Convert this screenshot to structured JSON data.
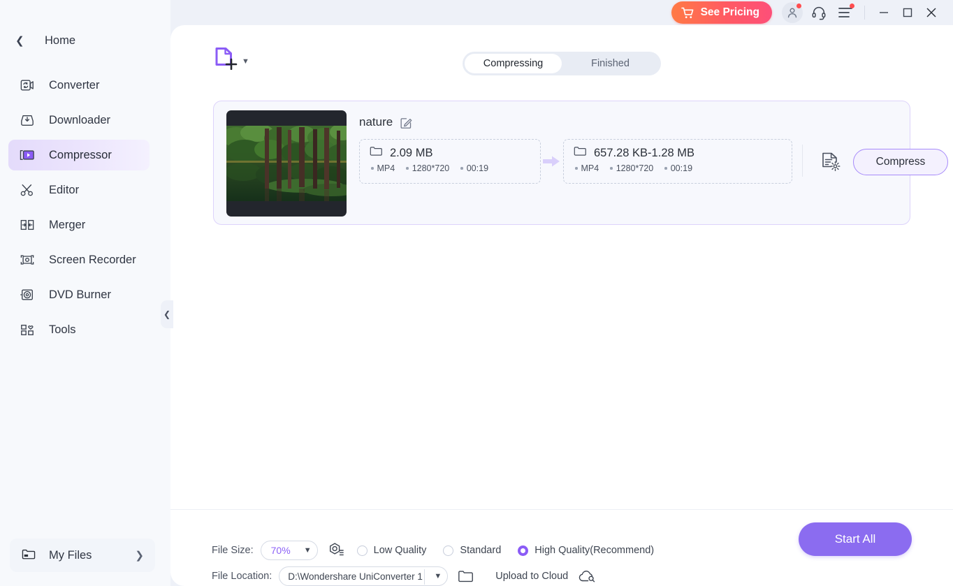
{
  "titlebar": {
    "pricing_label": "See Pricing",
    "cart_icon": "cart-icon",
    "account_icon": "account-icon",
    "support_icon": "headset-icon",
    "menu_icon": "hamburger-menu-icon",
    "minimize_icon": "minimize-icon",
    "maximize_icon": "maximize-icon",
    "close_icon": "close-icon"
  },
  "sidebar": {
    "back_icon": "chevron-left-icon",
    "home_label": "Home",
    "items": [
      {
        "label": "Converter",
        "icon": "converter-icon",
        "active": false
      },
      {
        "label": "Downloader",
        "icon": "downloader-icon",
        "active": false
      },
      {
        "label": "Compressor",
        "icon": "compressor-icon",
        "active": true
      },
      {
        "label": "Editor",
        "icon": "scissors-icon",
        "active": false
      },
      {
        "label": "Merger",
        "icon": "merger-icon",
        "active": false
      },
      {
        "label": "Screen Recorder",
        "icon": "screen-recorder-icon",
        "active": false
      },
      {
        "label": "DVD Burner",
        "icon": "dvd-burner-icon",
        "active": false
      },
      {
        "label": "Tools",
        "icon": "tools-grid-icon",
        "active": false
      }
    ],
    "my_files_label": "My Files",
    "my_files_icon": "folder-icon",
    "my_files_arrow": "chevron-right-icon",
    "collapse_icon": "chevron-left-icon"
  },
  "main": {
    "add_file_icon": "add-file-icon",
    "add_file_caret": "chevron-down-icon",
    "tabs": [
      {
        "label": "Compressing",
        "active": true
      },
      {
        "label": "Finished",
        "active": false
      }
    ]
  },
  "file_card": {
    "name": "nature",
    "edit_icon": "edit-pencil-icon",
    "thumbnail_alt": "forest-lake-thumbnail",
    "source": {
      "folder_icon": "folder-icon",
      "size": "2.09 MB",
      "format": "MP4",
      "resolution": "1280*720",
      "duration": "00:19"
    },
    "arrow_icon": "arrow-right-icon",
    "target": {
      "folder_icon": "folder-icon",
      "size": "657.28 KB-1.28 MB",
      "format": "MP4",
      "resolution": "1280*720",
      "duration": "00:19"
    },
    "settings_icon": "file-settings-icon",
    "compress_label": "Compress"
  },
  "bottom": {
    "file_size_label": "File Size:",
    "file_size_value": "70%",
    "file_size_caret": "chevron-down-icon",
    "preview_icon": "compare-preview-icon",
    "quality_options": [
      {
        "label": "Low Quality",
        "selected": false
      },
      {
        "label": "Standard",
        "selected": false
      },
      {
        "label": "High Quality(Recommend)",
        "selected": true
      }
    ],
    "file_location_label": "File Location:",
    "file_location_value": "D:\\Wondershare UniConverter 1",
    "file_location_caret": "chevron-down-icon",
    "open_folder_icon": "open-folder-icon",
    "upload_cloud_label": "Upload to Cloud",
    "upload_cloud_icon": "cloud-upload-icon",
    "start_all_label": "Start All"
  },
  "colors": {
    "accent": "#8b5cf6",
    "accent_button": "#8b6cf0",
    "pricing_gradient_start": "#ff7a45",
    "pricing_gradient_end": "#fd4f79",
    "app_bg": "#eef1f8",
    "sidebar_bg": "#f7f9fc",
    "panel_bg": "#ffffff",
    "card_bg": "#f7f8fd",
    "card_border": "#ddd3fb",
    "badge_red": "#ff4d4f"
  }
}
